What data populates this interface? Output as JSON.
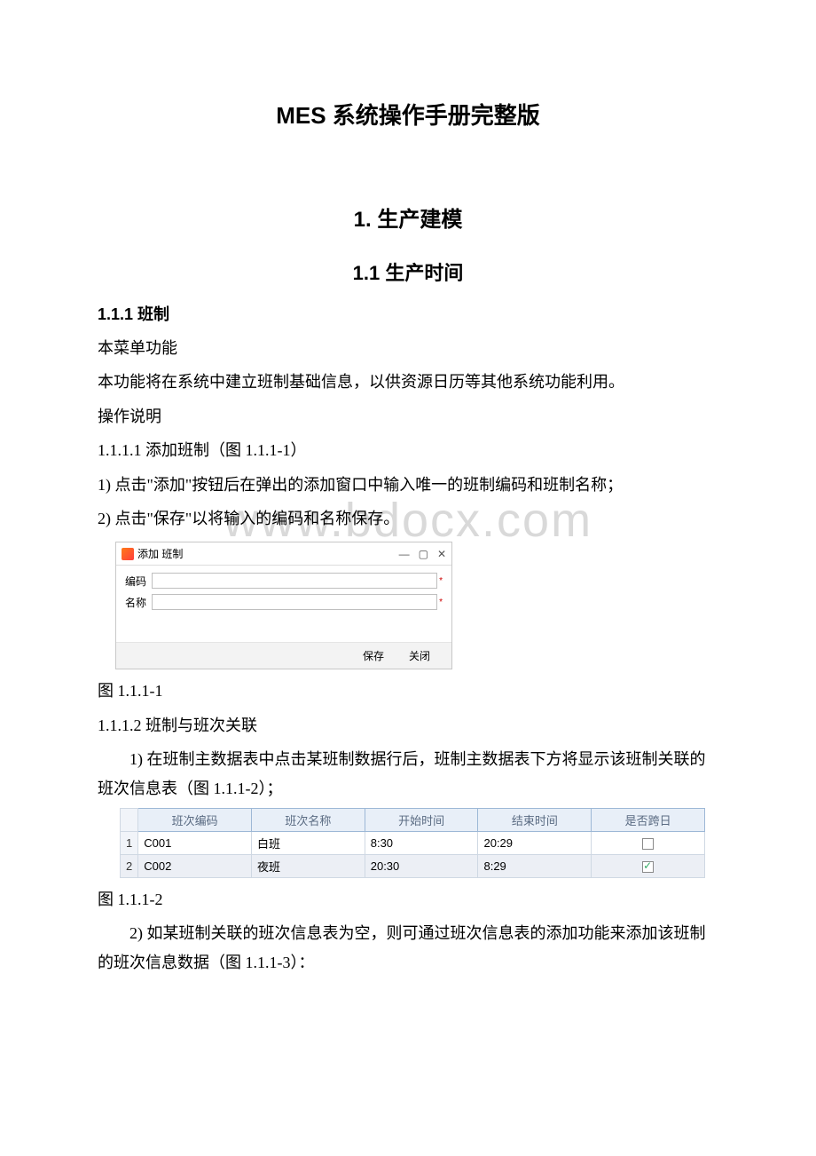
{
  "doc": {
    "title": "MES 系统操作手册完整版",
    "h1": "1. 生产建模",
    "h2": "1.1 生产时间",
    "h3": "1.1.1 班制",
    "p1": "本菜单功能",
    "p2": "本功能将在系统中建立班制基础信息，以供资源日历等其他系统功能利用。",
    "p3": "操作说明",
    "p4": "1.1.1.1 添加班制（图 1.1.1-1）",
    "p5": "1) 点击\"添加\"按钮后在弹出的添加窗口中输入唯一的班制编码和班制名称；",
    "p6": "2) 点击\"保存\"以将输入的编码和名称保存。",
    "caption1": "图 1.1.1-1",
    "p7": "1.1.1.2 班制与班次关联",
    "p8": "1) 在班制主数据表中点击某班制数据行后，班制主数据表下方将显示该班制关联的班次信息表（图 1.1.1-2）；",
    "caption2": "图 1.1.1-2",
    "p9": "2) 如某班制关联的班次信息表为空，则可通过班次信息表的添加功能来添加该班制的班次信息数据（图 1.1.1-3）："
  },
  "watermark": "www.bdocx.com",
  "dialog": {
    "title": "添加 班制",
    "labels": {
      "code": "编码",
      "name": "名称"
    },
    "buttons": {
      "save": "保存",
      "close": "关闭"
    },
    "winctrl": {
      "min": "—",
      "max": "▢",
      "close": "✕"
    }
  },
  "table": {
    "headers": [
      "班次编码",
      "班次名称",
      "开始时间",
      "结束时间",
      "是否跨日"
    ],
    "rows": [
      {
        "num": "1",
        "code": "C001",
        "name": "白班",
        "start": "8:30",
        "end": "20:29",
        "cross": false
      },
      {
        "num": "2",
        "code": "C002",
        "name": "夜班",
        "start": "20:30",
        "end": "8:29",
        "cross": true
      }
    ]
  }
}
